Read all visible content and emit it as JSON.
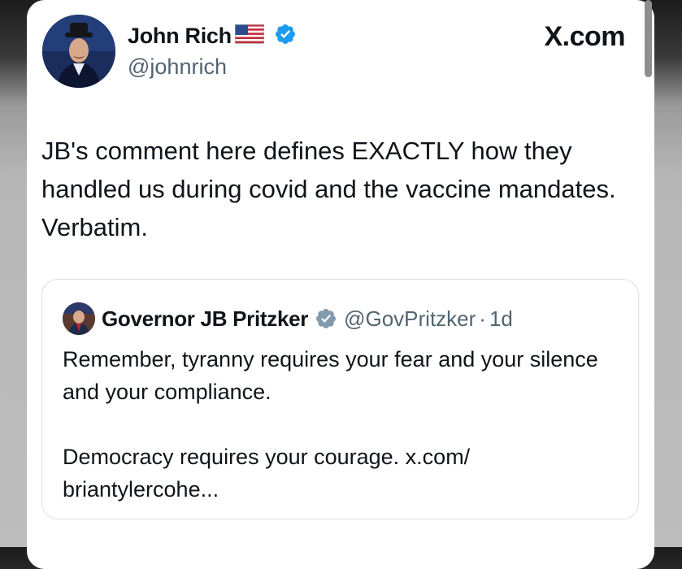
{
  "tweet": {
    "author_name": "John Rich",
    "author_handle": "@johnrich",
    "brand": "X.com",
    "text": "JB's comment here defines EXACTLY how they handled us during covid and the vaccine mandates. Verbatim."
  },
  "quoted_tweet": {
    "author_name": "Governor JB Pritzker",
    "author_handle": "@GovPritzker",
    "separator": "·",
    "time": "1d",
    "text": "Remember, tyranny requires your fear and your silence and your compliance.\n\nDemocracy requires your courage. x.com/\nbriantylercohe..."
  },
  "icons": {
    "flag": "us-flag-icon",
    "verified": "verified-badge-icon",
    "gov_verified": "government-verified-badge-icon"
  },
  "colors": {
    "verified_blue": "#1d9bf0",
    "gov_gray": "#829aab",
    "text": "#0f1419",
    "secondary": "#536471"
  }
}
